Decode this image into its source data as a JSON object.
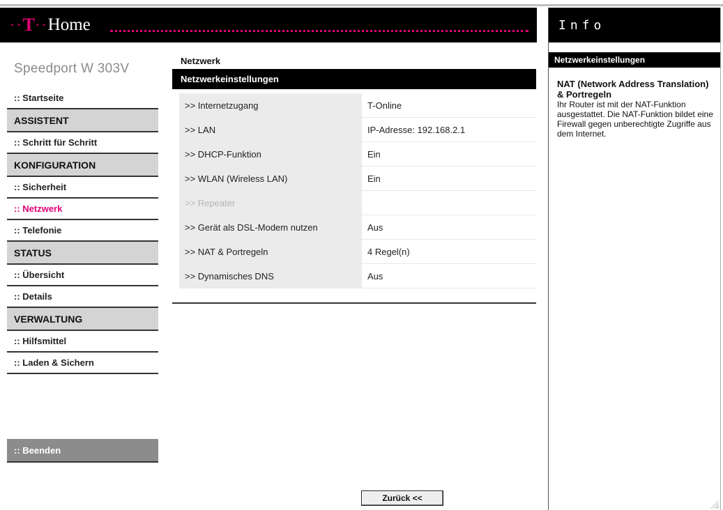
{
  "header": {
    "logo_mark": "T",
    "logo_text": "Home",
    "logo_dots": "··"
  },
  "brand": "Speedport W 303V",
  "nav": {
    "items": [
      {
        "label": ":: Startseite",
        "type": "item"
      },
      {
        "label": "ASSISTENT",
        "type": "section"
      },
      {
        "label": ":: Schritt für Schritt",
        "type": "item"
      },
      {
        "label": "KONFIGURATION",
        "type": "section"
      },
      {
        "label": ":: Sicherheit",
        "type": "item"
      },
      {
        "label": ":: Netzwerk",
        "type": "item",
        "active": true
      },
      {
        "label": ":: Telefonie",
        "type": "item"
      },
      {
        "label": "STATUS",
        "type": "section"
      },
      {
        "label": ":: Übersicht",
        "type": "item"
      },
      {
        "label": ":: Details",
        "type": "item"
      },
      {
        "label": "VERWALTUNG",
        "type": "section"
      },
      {
        "label": ":: Hilfsmittel",
        "type": "item"
      },
      {
        "label": ":: Laden & Sichern",
        "type": "item"
      }
    ],
    "logout": ":: Beenden"
  },
  "main": {
    "page_title": "Netzwerk",
    "section_title": "Netzwerkeinstellungen",
    "rows": [
      {
        "label": ">> Internetzugang",
        "value": "T-Online"
      },
      {
        "label": ">> LAN",
        "value": "IP-Adresse: 192.168.2.1"
      },
      {
        "label": ">> DHCP-Funktion",
        "value": "Ein"
      },
      {
        "label": ">> WLAN (Wireless LAN)",
        "value": "Ein"
      },
      {
        "label": ">> Repeater",
        "value": "",
        "disabled": true
      },
      {
        "label": ">> Gerät als DSL-Modem nutzen",
        "value": "Aus"
      },
      {
        "label": ">> NAT & Portregeln",
        "value": "4 Regel(n)"
      },
      {
        "label": ">> Dynamisches DNS",
        "value": "Aus"
      }
    ],
    "back_button": "Zurück <<"
  },
  "info": {
    "header": "Info",
    "subheader": "Netzwerkeinstellungen",
    "title": "NAT (Network Address Translation) & Portregeln",
    "text": "Ihr Router ist mit der NAT-Funktion ausgestattet. Die NAT-Funktion bildet eine Firewall gegen unberechtigte Zugriffe aus dem Internet."
  },
  "colors": {
    "brand_magenta": "#e20074",
    "header_black": "#000000",
    "section_gray": "#d4d4d4"
  }
}
